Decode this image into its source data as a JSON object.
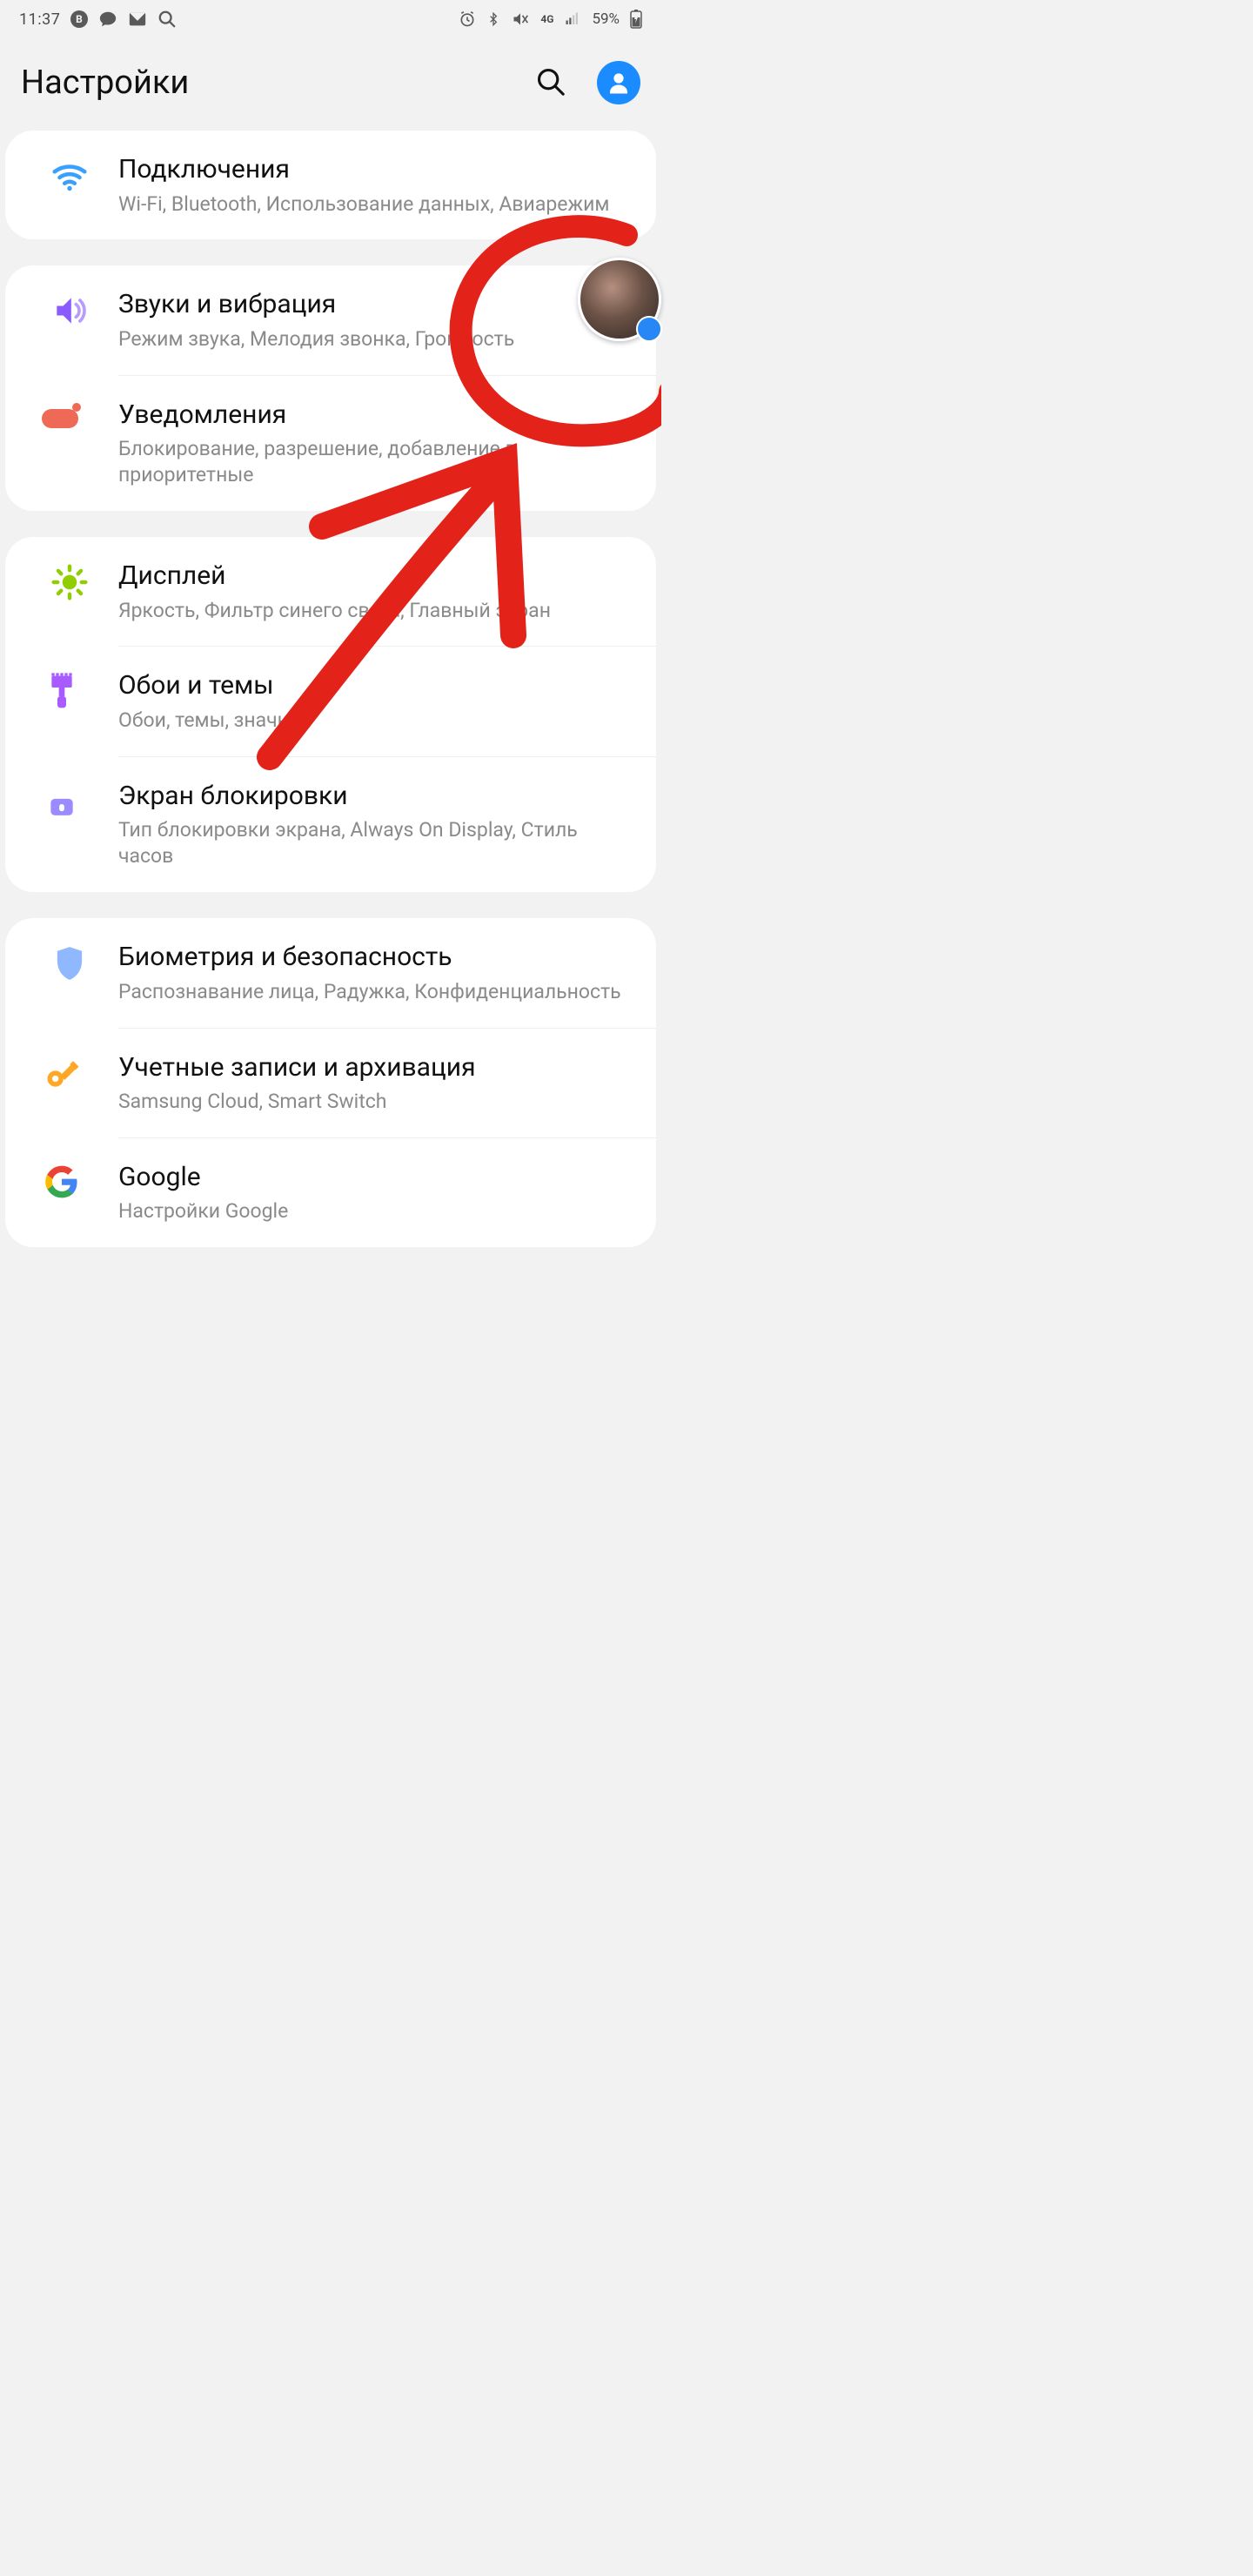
{
  "status": {
    "clock": "11:37",
    "network_label": "4G",
    "battery_text": "59%"
  },
  "header": {
    "title": "Настройки"
  },
  "groups": [
    {
      "rows": [
        {
          "id": "connections",
          "title": "Подключения",
          "sub": "Wi-Fi, Bluetooth, Использование данных, Авиарежим"
        }
      ]
    },
    {
      "rows": [
        {
          "id": "sounds",
          "title": "Звуки и вибрация",
          "sub": "Режим звука, Мелодия звонка, Громкость"
        },
        {
          "id": "notifications",
          "title": "Уведомления",
          "sub": "Блокирование, разрешение, добавление в приоритетные"
        }
      ]
    },
    {
      "rows": [
        {
          "id": "display",
          "title": "Дисплей",
          "sub": "Яркость, Фильтр синего света, Главный экран"
        },
        {
          "id": "wallpaper",
          "title": "Обои и темы",
          "sub": "Обои, темы, значки"
        },
        {
          "id": "lockscreen",
          "title": "Экран блокировки",
          "sub": "Тип блокировки экрана, Always On Display, Стиль часов"
        }
      ]
    },
    {
      "rows": [
        {
          "id": "biometrics",
          "title": "Биометрия и безопасность",
          "sub": "Распознавание лица, Радужка, Конфиденциальность"
        },
        {
          "id": "accounts",
          "title": "Учетные записи и архивация",
          "sub": "Samsung Cloud, Smart Switch"
        },
        {
          "id": "google",
          "title": "Google",
          "sub": "Настройки Google"
        }
      ]
    }
  ]
}
